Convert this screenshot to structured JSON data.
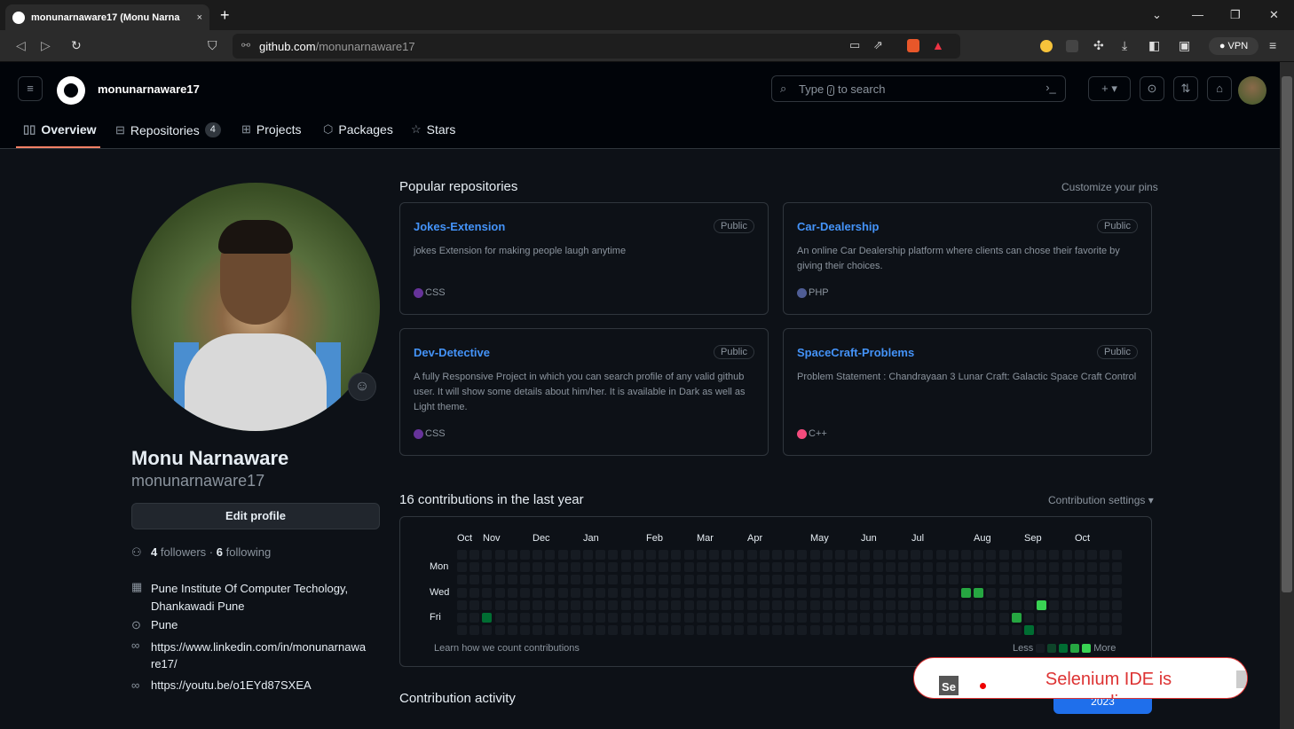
{
  "browser": {
    "tab_title": "monunarnaware17 (Monu Narna",
    "tab_close": "×",
    "new_tab": "+",
    "url_host": "github.com",
    "url_path": "/monunarnaware17",
    "vpn_label": "● VPN"
  },
  "header": {
    "username": "monunarnaware17",
    "search_prefix": "Type",
    "search_key": "/",
    "search_suffix": "to search",
    "terminal_icon": "›_",
    "plus_label": "+ ▾",
    "tabs": [
      {
        "label": "Overview",
        "icon": "book-icon"
      },
      {
        "label": "Repositories",
        "count": "4",
        "icon": "repo-icon"
      },
      {
        "label": "Projects",
        "icon": "table-icon"
      },
      {
        "label": "Packages",
        "icon": "package-icon"
      },
      {
        "label": "Stars",
        "icon": "star-icon"
      }
    ]
  },
  "profile": {
    "name": "Monu Narnaware",
    "login": "monunarnaware17",
    "edit_label": "Edit profile",
    "followers_count": "4",
    "followers_label": "followers",
    "separator": "·",
    "following_count": "6",
    "following_label": "following",
    "company_line1": "Pune Institute Of Computer Techology,",
    "company_line2": "Dhankawadi Pune",
    "location": "Pune",
    "linkedin_line1": "https://www.linkedin.com/in/monunarnawa",
    "linkedin_line2": "re17/",
    "youtube": "https://youtu.be/o1EYd87SXEA"
  },
  "popular": {
    "title": "Popular repositories",
    "customize": "Customize your pins",
    "repos": [
      {
        "name": "Jokes-Extension",
        "visibility": "Public",
        "desc": "jokes Extension for making people laugh anytime",
        "lang": "CSS",
        "lang_color": "#663399"
      },
      {
        "name": "Car-Dealership",
        "visibility": "Public",
        "desc": "An online Car Dealership platform where clients can chose their favorite by giving their choices.",
        "lang": "PHP",
        "lang_color": "#4f5d95"
      },
      {
        "name": "Dev-Detective",
        "visibility": "Public",
        "desc": "A fully Responsive Project in which you can search profile of any valid github user. It will show some details about him/her. It is available in Dark as well as Light theme.",
        "lang": "CSS",
        "lang_color": "#663399"
      },
      {
        "name": "SpaceCraft-Problems",
        "visibility": "Public",
        "desc": "Problem Statement : Chandrayaan 3 Lunar Craft: Galactic Space Craft Control",
        "lang": "C++",
        "lang_color": "#f34b7d"
      }
    ]
  },
  "contributions": {
    "title": "16 contributions in the last year",
    "settings": "Contribution settings ▾",
    "months": [
      "Oct",
      "Nov",
      "Dec",
      "Jan",
      "Feb",
      "Mar",
      "Apr",
      "May",
      "Jun",
      "Jul",
      "Aug",
      "Sep",
      "Oct"
    ],
    "days": [
      "Mon",
      "Wed",
      "Fri"
    ],
    "learn": "Learn how we count contributions",
    "less": "Less",
    "more": "More",
    "colors": {
      "empty": "#161b22",
      "l1": "#0e4429",
      "l2": "#006d32",
      "l3": "#26a641",
      "l4": "#39d353"
    },
    "active_cells": [
      {
        "week": 2,
        "day": 5,
        "level": "l2"
      },
      {
        "week": 40,
        "day": 3,
        "level": "l3"
      },
      {
        "week": 41,
        "day": 3,
        "level": "l3"
      },
      {
        "week": 44,
        "day": 5,
        "level": "l3"
      },
      {
        "week": 45,
        "day": 6,
        "level": "l2"
      },
      {
        "week": 46,
        "day": 4,
        "level": "l4"
      }
    ]
  },
  "activity": {
    "title": "Contribution activity",
    "year": "2023"
  },
  "selenium": {
    "logo": "Se",
    "message": "Selenium IDE is recording..."
  }
}
